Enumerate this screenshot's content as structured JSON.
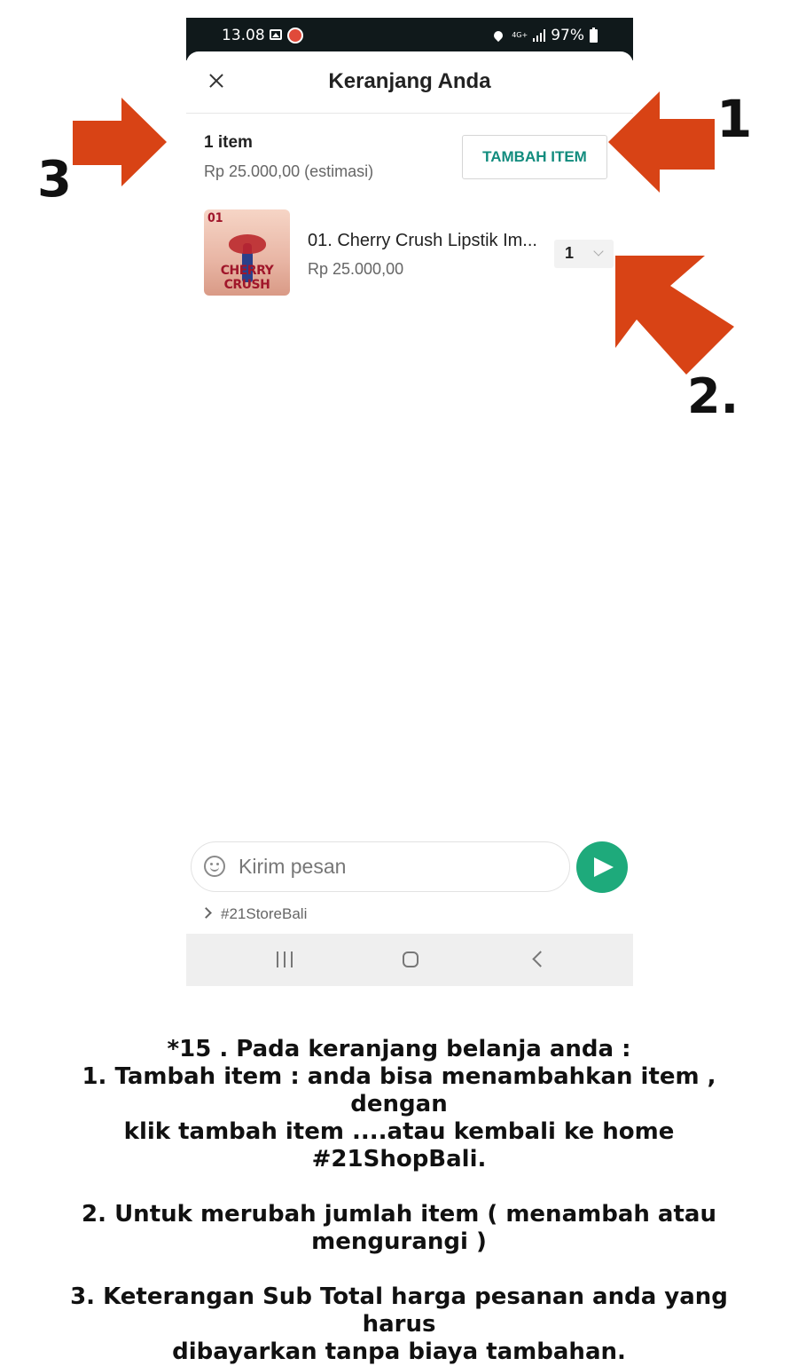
{
  "status_bar": {
    "time": "13.08",
    "network": "4G+",
    "battery": "97%"
  },
  "header": {
    "title": "Keranjang Anda"
  },
  "cart_summary": {
    "count": "1 item",
    "estimate": "Rp 25.000,00 (estimasi)",
    "add_item_label": "TAMBAH ITEM"
  },
  "cart_items": [
    {
      "image_number": "01",
      "image_name": "CHERRY CRUSH",
      "name": "01. Cherry Crush Lipstik Im...",
      "price": "Rp 25.000,00",
      "quantity": "1"
    }
  ],
  "composer": {
    "placeholder": "Kirim pesan",
    "store_link": "#21StoreBali"
  },
  "annotations": {
    "label_1": "1",
    "label_2": "2.",
    "label_3": "3",
    "arrow_color": "#d84315"
  },
  "instructions": {
    "line_intro": "*15 . Pada keranjang belanja anda :",
    "line_1a": "1.  Tambah item : anda bisa menambahkan item , dengan",
    "line_1b": "klik tambah item ....atau kembali ke home #21ShopBali.",
    "line_2a": "2. Untuk merubah jumlah item ( menambah atau",
    "line_2b": "mengurangi )",
    "line_3a": "3. Keterangan Sub Total harga pesanan anda yang harus",
    "line_3b": "dibayarkan tanpa biaya tambahan."
  }
}
